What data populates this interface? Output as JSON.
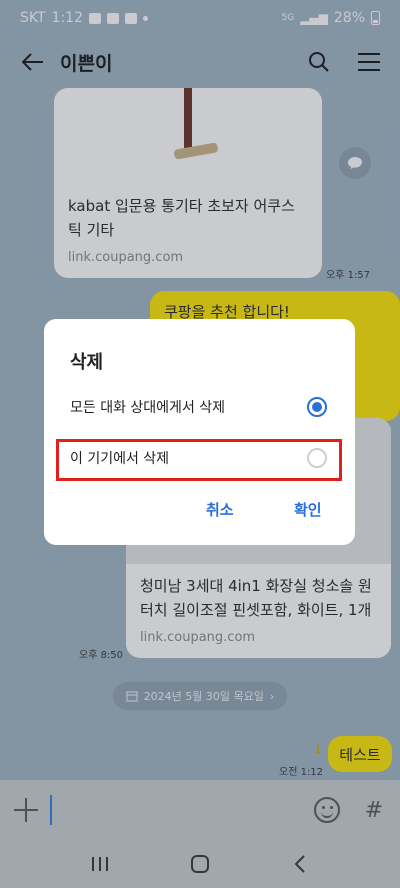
{
  "status_bar": {
    "carrier": "SKT",
    "time": "1:12",
    "network": "5G",
    "battery": "28%"
  },
  "header": {
    "title": "이쁜이"
  },
  "messages": {
    "link_card_1": {
      "title": "kabat 입문용 통기타 초보자 어쿠스틱 기타",
      "link": "link.coupang.com",
      "time": "오후 1:57"
    },
    "bubble_1": {
      "text": "쿠팡을 추천 합니다!"
    },
    "link_card_2": {
      "title": "청미남 3세대 4in1 화장실 청소솔 원터치 길이조절 핀셋포함, 화이트, 1개",
      "link": "link.coupang.com",
      "time": "오후 8:50"
    },
    "date_divider": "2024년 5월 30일 목요일",
    "last_message": {
      "text": "테스트",
      "read_count": "1",
      "time": "오전 1:12"
    }
  },
  "dialog": {
    "title": "삭제",
    "options": [
      {
        "label": "모든 대화 상대에게서 삭제",
        "selected": true
      },
      {
        "label": "이 기기에서 삭제",
        "selected": false
      }
    ],
    "cancel_label": "취소",
    "confirm_label": "확인",
    "highlight_color": "#e0211c",
    "accent_color": "#2b6fdb"
  },
  "input_bar": {
    "value": ""
  },
  "icons": [
    "back-arrow-icon",
    "search-icon",
    "menu-icon",
    "share-icon",
    "calendar-icon",
    "plus-icon",
    "emoji-icon",
    "hash-icon",
    "recent-apps-icon",
    "home-icon",
    "back-icon"
  ]
}
